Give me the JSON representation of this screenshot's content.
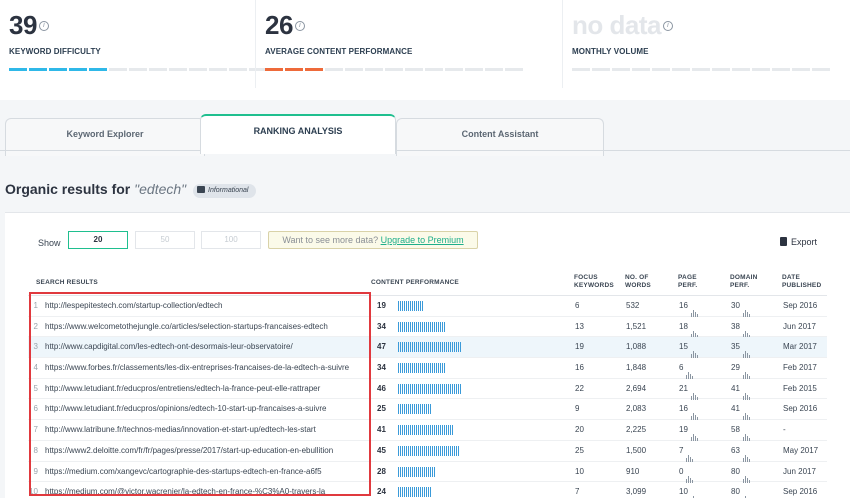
{
  "metrics": [
    {
      "value": "39",
      "label": "KEYWORD DIFFICULTY",
      "color": "#2fb8e8",
      "filled": 5,
      "total": 13
    },
    {
      "value": "26",
      "label": "AVERAGE CONTENT PERFORMANCE",
      "color": "#ee6a3a",
      "filled": 3,
      "total": 13
    },
    {
      "value": "no data",
      "label": "MONTHLY VOLUME",
      "color": "#e6e9ec",
      "filled": 0,
      "total": 13
    }
  ],
  "tabs": {
    "keyword_explorer": "Keyword Explorer",
    "ranking_analysis": "RANKING ANALYSIS",
    "content_assistant": "Content Assistant"
  },
  "organic": {
    "title": "Organic results for",
    "query": "\"edtech\"",
    "badge": "Informational"
  },
  "controls": {
    "show_label": "Show",
    "show_options": [
      "20",
      "50",
      "100"
    ],
    "promo_text": "Want to see more data?",
    "promo_link": "Upgrade to Premium",
    "export_label": "Export"
  },
  "table": {
    "headers": {
      "search_results": "SEARCH RESULTS",
      "content_performance": "CONTENT PERFORMANCE",
      "focus_keywords_1": "FOCUS",
      "focus_keywords_2": "KEYWORDS",
      "words_1": "NO. OF",
      "words_2": "WORDS",
      "page_perf_1": "PAGE",
      "page_perf_2": "PERF.",
      "domain_perf_1": "DOMAIN",
      "domain_perf_2": "PERF.",
      "date_1": "DATE",
      "date_2": "PUBLISHED"
    },
    "rows": [
      {
        "idx": "1",
        "url": "http://lespepitestech.com/startup-collection/edtech",
        "cp": "19",
        "fk": "6",
        "words": "532",
        "page": "16",
        "domain": "30",
        "date": "Sep 2016"
      },
      {
        "idx": "2",
        "url": "https://www.welcometothejungle.co/articles/selection-startups-francaises-edtech",
        "cp": "34",
        "fk": "13",
        "words": "1,521",
        "page": "18",
        "domain": "38",
        "date": "Jun 2017"
      },
      {
        "idx": "3",
        "url": "http://www.capdigital.com/les-edtech-ont-desormais-leur-observatoire/",
        "cp": "47",
        "fk": "19",
        "words": "1,088",
        "page": "15",
        "domain": "35",
        "date": "Mar 2017"
      },
      {
        "idx": "4",
        "url": "https://www.forbes.fr/classements/les-dix-entreprises-francaises-de-la-edtech-a-suivre",
        "cp": "34",
        "fk": "16",
        "words": "1,848",
        "page": "6",
        "domain": "29",
        "date": "Feb 2017"
      },
      {
        "idx": "5",
        "url": "http://www.letudiant.fr/educpros/entretiens/edtech-la-france-peut-elle-rattraper",
        "cp": "46",
        "fk": "22",
        "words": "2,694",
        "page": "21",
        "domain": "41",
        "date": "Feb 2015"
      },
      {
        "idx": "6",
        "url": "http://www.letudiant.fr/educpros/opinions/edtech-10-start-up-francaises-a-suivre",
        "cp": "25",
        "fk": "9",
        "words": "2,083",
        "page": "16",
        "domain": "41",
        "date": "Sep 2016"
      },
      {
        "idx": "7",
        "url": "http://www.latribune.fr/technos-medias/innovation-et-start-up/edtech-les-start",
        "cp": "41",
        "fk": "20",
        "words": "2,225",
        "page": "19",
        "domain": "58",
        "date": "-"
      },
      {
        "idx": "8",
        "url": "https://www2.deloitte.com/fr/fr/pages/presse/2017/start-up-education-en-ebullition",
        "cp": "45",
        "fk": "25",
        "words": "1,500",
        "page": "7",
        "domain": "63",
        "date": "May 2017"
      },
      {
        "idx": "9",
        "url": "https://medium.com/xangevc/cartographie-des-startups-edtech-en-france-a6f5",
        "cp": "28",
        "fk": "10",
        "words": "910",
        "page": "0",
        "domain": "80",
        "date": "Jun 2017"
      },
      {
        "idx": "10",
        "url": "https://medium.com/@victor.wacrenier/la-edtech-en-france-%C3%A0-travers-la",
        "cp": "24",
        "fk": "7",
        "words": "3,099",
        "page": "10",
        "domain": "80",
        "date": "Sep 2016"
      }
    ]
  }
}
